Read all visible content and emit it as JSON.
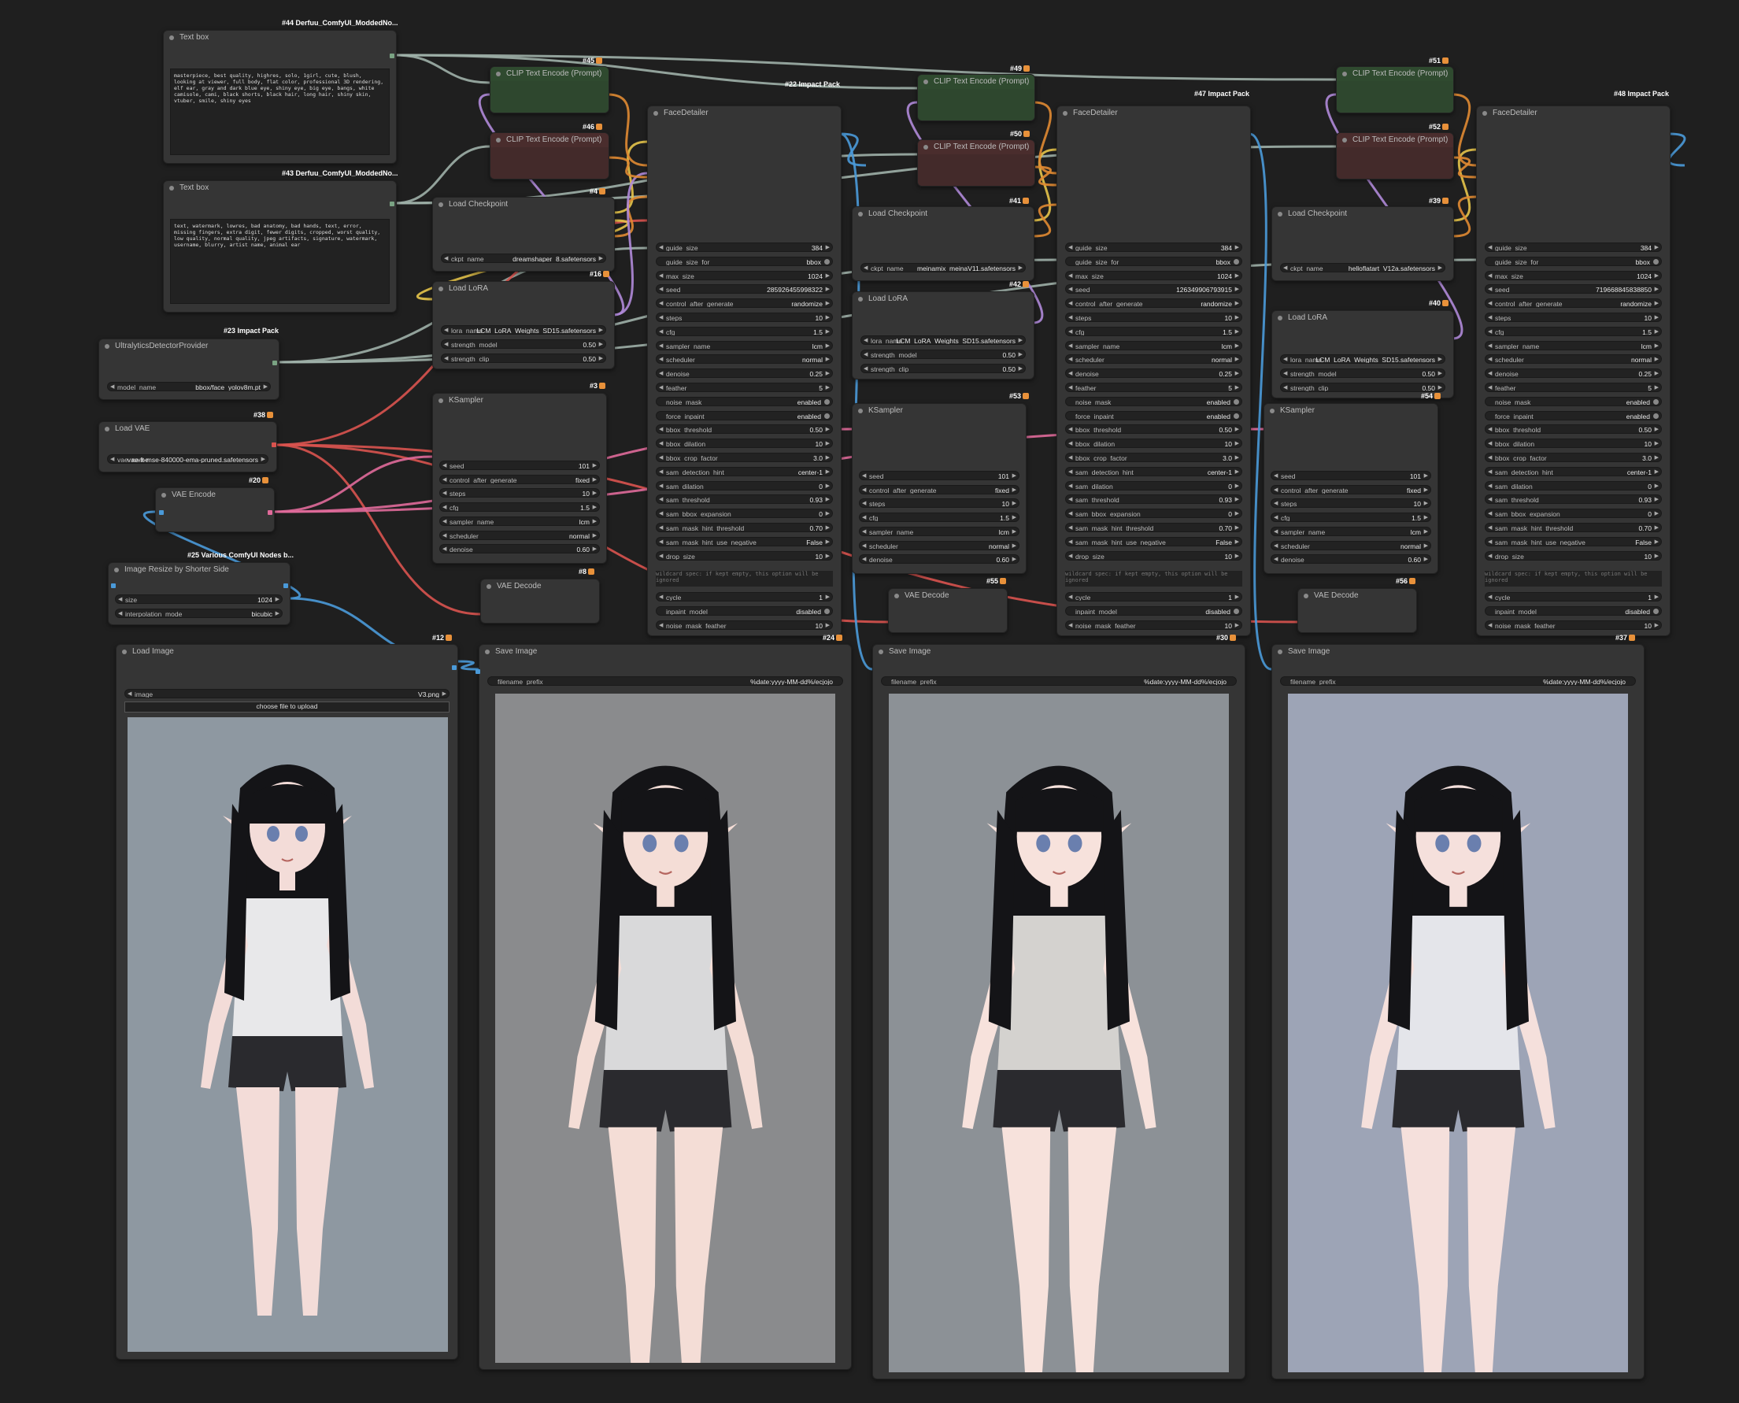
{
  "textbox_pos": {
    "tag": "#44 Derfuu_ComfyUI_ModdedNo...",
    "title": "Text box",
    "text": "masterpiece, best quality, highres, solo, 1girl, cute, blush, looking at viewer, full body, flat color, professional 3D rendering, elf ear, gray and dark blue eye, shiny eye, big eye, bangs, white camisole, cami, black shorts, black hair, long hair, shiny skin, vtuber, smile, shiny eyes"
  },
  "textbox_neg": {
    "tag": "#43 Derfuu_ComfyUI_ModdedNo...",
    "title": "Text box",
    "text": "text, watermark, lowres, bad anatomy, bad hands, text, error, missing fingers, extra digit, fewer digits, cropped, worst quality, low quality, normal quality, jpeg artifacts, signature, watermark, username, blurry, artist name, animal ear"
  },
  "detector": {
    "tag": "#23 Impact Pack",
    "title": "UltralyticsDetectorProvider",
    "w": "model_name",
    "v": "bbox/face_yolov8m.pt"
  },
  "vae_loader": {
    "tag": "#38",
    "title": "Load VAE",
    "w": "vae_name",
    "v": "vae-ft-mse-840000-ema-pruned.safetensors"
  },
  "vae_encode": {
    "tag": "#20",
    "title": "VAE Encode"
  },
  "resize": {
    "tag": "#25 Various ComfyUI Nodes b...",
    "title": "Image Resize by Shorter Side",
    "w1": "size",
    "v1": "1024",
    "w2": "interpolation_mode",
    "v2": "bicubic"
  },
  "load_image": {
    "tag": "#12",
    "title": "Load Image",
    "w": "image",
    "v": "V3.png",
    "upload": "choose file to upload"
  },
  "clip_title": "CLIP Text Encode (Prompt)",
  "clip_tags": [
    "#45",
    "#46",
    "#49",
    "#50",
    "#51",
    "#52"
  ],
  "ckpt": [
    {
      "tag": "#4",
      "title": "Load Checkpoint",
      "w": "ckpt_name",
      "v": "dreamshaper_8.safetensors"
    },
    {
      "tag": "#41",
      "title": "Load Checkpoint",
      "w": "ckpt_name",
      "v": "meinamix_meinaV11.safetensors"
    },
    {
      "tag": "#39",
      "title": "Load Checkpoint",
      "w": "ckpt_name",
      "v": "helloflatart_V12a.safetensors"
    }
  ],
  "lora": [
    {
      "tag": "#16",
      "title": "Load LoRA",
      "v": "LCM_LoRA_Weights_SD15.safetensors",
      "w1": "lora_name",
      "w2": "strength_model",
      "v2": "0.50",
      "w3": "strength_clip",
      "v3": "0.50"
    },
    {
      "tag": "#42",
      "title": "Load LoRA",
      "v": "LCM_LoRA_Weights_SD15.safetensors",
      "w1": "lora_name",
      "w2": "strength_model",
      "v2": "0.50",
      "w3": "strength_clip",
      "v3": "0.50"
    },
    {
      "tag": "#40",
      "title": "Load LoRA",
      "v": "LCM_LoRA_Weights_SD15.safetensors",
      "w1": "lora_name",
      "w2": "strength_model",
      "v2": "0.50",
      "w3": "strength_clip",
      "v3": "0.50"
    }
  ],
  "ksampler": [
    {
      "tag": "#3",
      "title": "KSampler",
      "rows": [
        [
          "seed",
          "101"
        ],
        [
          "control_after_generate",
          "fixed"
        ],
        [
          "steps",
          "10"
        ],
        [
          "cfg",
          "1.5"
        ],
        [
          "sampler_name",
          "lcm"
        ],
        [
          "scheduler",
          "normal"
        ],
        [
          "denoise",
          "0.60"
        ]
      ]
    },
    {
      "tag": "#53",
      "title": "KSampler",
      "rows": [
        [
          "seed",
          "101"
        ],
        [
          "control_after_generate",
          "fixed"
        ],
        [
          "steps",
          "10"
        ],
        [
          "cfg",
          "1.5"
        ],
        [
          "sampler_name",
          "lcm"
        ],
        [
          "scheduler",
          "normal"
        ],
        [
          "denoise",
          "0.60"
        ]
      ]
    },
    {
      "tag": "#54",
      "title": "KSampler",
      "rows": [
        [
          "seed",
          "101"
        ],
        [
          "control_after_generate",
          "fixed"
        ],
        [
          "steps",
          "10"
        ],
        [
          "cfg",
          "1.5"
        ],
        [
          "sampler_name",
          "lcm"
        ],
        [
          "scheduler",
          "normal"
        ],
        [
          "denoise",
          "0.60"
        ]
      ]
    }
  ],
  "vae_decode": [
    {
      "tag": "#8",
      "title": "VAE Decode"
    },
    {
      "tag": "#55",
      "title": "VAE Decode"
    },
    {
      "tag": "#56",
      "title": "VAE Decode"
    }
  ],
  "face_detailer": [
    {
      "tag": "#22 Impact Pack",
      "title": "FaceDetailer",
      "seed": "285926455998322"
    },
    {
      "tag": "#47 Impact Pack",
      "title": "FaceDetailer",
      "seed": "126349906793915"
    },
    {
      "tag": "#48 Impact Pack",
      "title": "FaceDetailer",
      "seed": "719668845838850"
    }
  ],
  "fd_rows": [
    [
      "guide_size",
      "384"
    ],
    [
      "guide_size_for",
      "bbox"
    ],
    [
      "max_size",
      "1024"
    ],
    [
      "seed",
      ""
    ],
    [
      "control_after_generate",
      "randomize"
    ],
    [
      "steps",
      "10"
    ],
    [
      "cfg",
      "1.5"
    ],
    [
      "sampler_name",
      "lcm"
    ],
    [
      "scheduler",
      "normal"
    ],
    [
      "denoise",
      "0.25"
    ],
    [
      "feather",
      "5"
    ],
    [
      "noise_mask",
      "enabled"
    ],
    [
      "force_inpaint",
      "enabled"
    ],
    [
      "bbox_threshold",
      "0.50"
    ],
    [
      "bbox_dilation",
      "10"
    ],
    [
      "bbox_crop_factor",
      "3.0"
    ],
    [
      "sam_detection_hint",
      "center-1"
    ],
    [
      "sam_dilation",
      "0"
    ],
    [
      "sam_threshold",
      "0.93"
    ],
    [
      "sam_bbox_expansion",
      "0"
    ],
    [
      "sam_mask_hint_threshold",
      "0.70"
    ],
    [
      "sam_mask_hint_use_negative",
      "False"
    ],
    [
      "drop_size",
      "10"
    ]
  ],
  "fd_wildcard": "wildcard spec: if kept empty, this option will be ignored",
  "fd_tail": [
    [
      "cycle",
      "1"
    ],
    [
      "inpaint_model",
      "disabled"
    ],
    [
      "noise_mask_feather",
      "10"
    ]
  ],
  "save_image": [
    {
      "tag": "#24",
      "title": "Save Image",
      "w": "filename_prefix",
      "v": "%date:yyyy-MM-dd%/ecjojo"
    },
    {
      "tag": "#30",
      "title": "Save Image",
      "w": "filename_prefix",
      "v": "%date:yyyy-MM-dd%/ecjojo"
    },
    {
      "tag": "#37",
      "title": "Save Image",
      "w": "filename_prefix",
      "v": "%date:yyyy-MM-dd%/ecjojo"
    }
  ],
  "colors": {
    "canvas": "#1f1f1f",
    "node": "#353535",
    "widget": "#222222",
    "clip_pos": "#2e472e",
    "clip_neg": "#432a2a",
    "wire_yellow": "#e6c44a",
    "wire_orange": "#e08a32",
    "wire_pink": "#e06a9a",
    "wire_red": "#d9534f",
    "wire_blue": "#4a9ad9",
    "wire_green": "#7aa383",
    "wire_purple": "#b08ad9",
    "wire_gray": "#9fb0a8"
  }
}
